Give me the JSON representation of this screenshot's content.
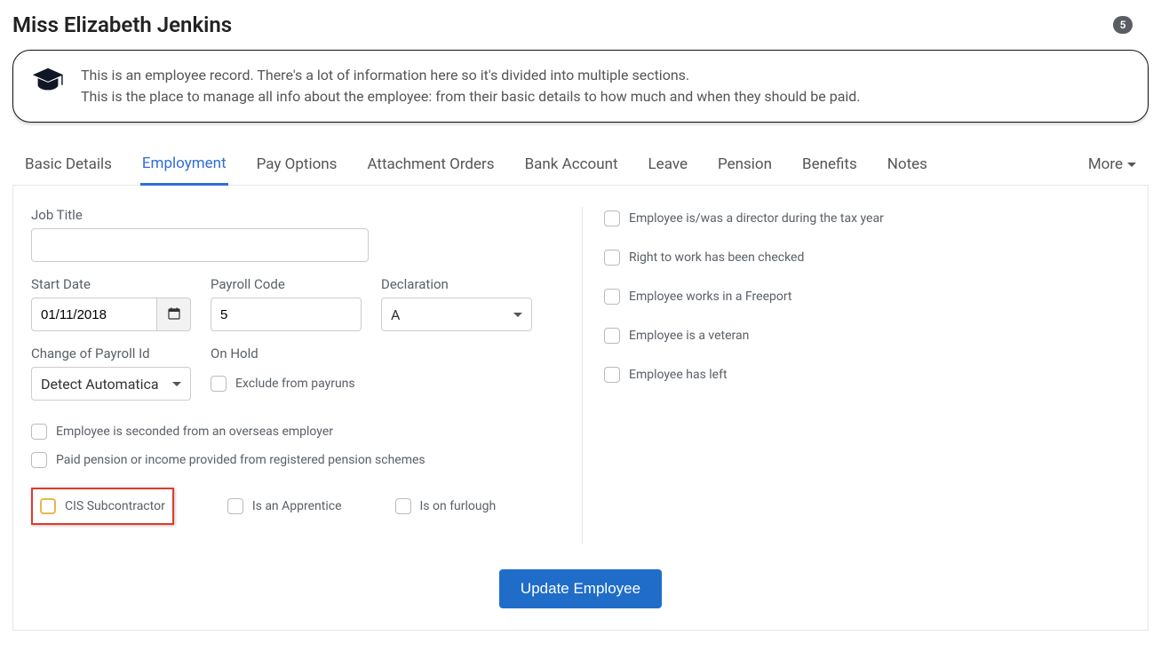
{
  "header": {
    "title": "Miss Elizabeth Jenkins",
    "badge": "5"
  },
  "info": {
    "line1": "This is an employee record. There's a lot of information here so it's divided into multiple sections.",
    "line2": "This is the place to manage all info about the employee: from their basic details to how much and when they should be paid."
  },
  "tabs": [
    "Basic Details",
    "Employment",
    "Pay Options",
    "Attachment Orders",
    "Bank Account",
    "Leave",
    "Pension",
    "Benefits",
    "Notes"
  ],
  "tab_more": "More",
  "active_tab_index": 1,
  "form": {
    "job_title": {
      "label": "Job Title",
      "value": ""
    },
    "start_date": {
      "label": "Start Date",
      "value": "01/11/2018"
    },
    "payroll_code": {
      "label": "Payroll Code",
      "value": "5"
    },
    "declaration": {
      "label": "Declaration",
      "value": "A"
    },
    "change_payroll_id": {
      "label": "Change of Payroll Id",
      "value": "Detect Automatica"
    },
    "on_hold": {
      "label": "On Hold",
      "checkbox_label": "Exclude from payruns"
    },
    "left_checks": {
      "seconded": "Employee is seconded from an overseas employer",
      "paid_pension": "Paid pension or income provided from registered pension schemes",
      "cis": "CIS Subcontractor",
      "apprentice": "Is an Apprentice",
      "furlough": "Is on furlough"
    },
    "right_checks": {
      "director": "Employee is/was a director during the tax year",
      "right_to_work": "Right to work has been checked",
      "freeport": "Employee works in a Freeport",
      "veteran": "Employee is a veteran",
      "left": "Employee has left"
    },
    "submit": "Update Employee"
  }
}
